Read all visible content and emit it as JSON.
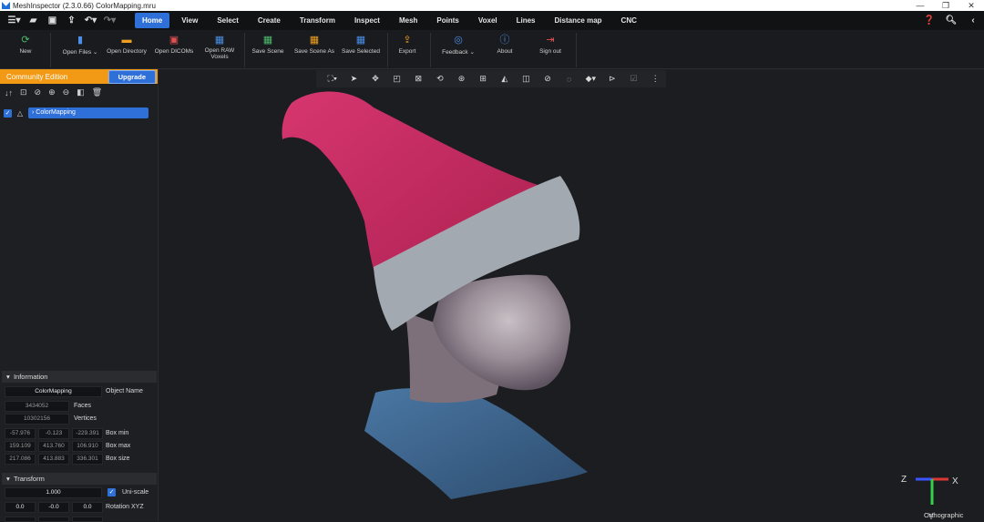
{
  "window": {
    "title": "MeshInspector (2.3.0.66) ColorMapping.mru",
    "controls": [
      "—",
      "❐",
      "✕"
    ]
  },
  "quick_access": {
    "icons": [
      "menu-icon",
      "folder-open-icon",
      "save-icon",
      "export-icon",
      "undo-icon",
      "redo-icon"
    ]
  },
  "menu": {
    "tabs": [
      {
        "label": "Home",
        "active": true
      },
      {
        "label": "View"
      },
      {
        "label": "Select"
      },
      {
        "label": "Create"
      },
      {
        "label": "Transform"
      },
      {
        "label": "Inspect"
      },
      {
        "label": "Mesh"
      },
      {
        "label": "Points"
      },
      {
        "label": "Voxel"
      },
      {
        "label": "Lines"
      },
      {
        "label": "Distance map"
      },
      {
        "label": "CNC"
      }
    ],
    "right_icons": [
      "help-icon",
      "search-icon",
      "collapse-icon"
    ]
  },
  "ribbon": {
    "new": "New",
    "open_files": "Open Files",
    "open_directory": "Open Directory",
    "open_dicoms": "Open DICOMs",
    "open_raw_1": "Open RAW",
    "open_raw_2": "Voxels",
    "save_scene": "Save Scene",
    "save_scene_as": "Save Scene As",
    "save_selected": "Save Selected",
    "export": "Export",
    "feedback": "Feedback",
    "about": "About",
    "sign_out": "Sign out"
  },
  "left_panel": {
    "edition": "Community Edition",
    "upgrade": "Upgrade",
    "tree_item": "ColorMapping",
    "information": {
      "header": "Information",
      "object_name_value": "ColorMapping",
      "object_name_label": "Object Name",
      "faces_value": "3434052",
      "faces_label": "Faces",
      "vertices_value": "10302156",
      "vertices_label": "Vertices",
      "box_min": [
        "-57.976",
        "-0.123",
        "-229.391"
      ],
      "box_min_label": "Box min",
      "box_max": [
        "159.109",
        "413.760",
        "106.910"
      ],
      "box_max_label": "Box max",
      "box_size": [
        "217.086",
        "413.883",
        "336.301"
      ],
      "box_size_label": "Box size"
    },
    "transform": {
      "header": "Transform",
      "scale_value": "1.000",
      "uniscale_label": "Uni-scale",
      "rotation": [
        "0.0",
        "-0.0",
        "0.0"
      ],
      "rotation_label": "Rotation XYZ"
    }
  },
  "viewport": {
    "axis_z": "Z",
    "axis_x": "X",
    "axis_y": "Y",
    "projection": "Orthographic"
  },
  "colors": {
    "accent": "#2e6fd8",
    "edition_bar": "#f29a16",
    "hat": "#c4275e",
    "hat_brim": "#a3a9b0",
    "shirt": "#3b5f86"
  }
}
